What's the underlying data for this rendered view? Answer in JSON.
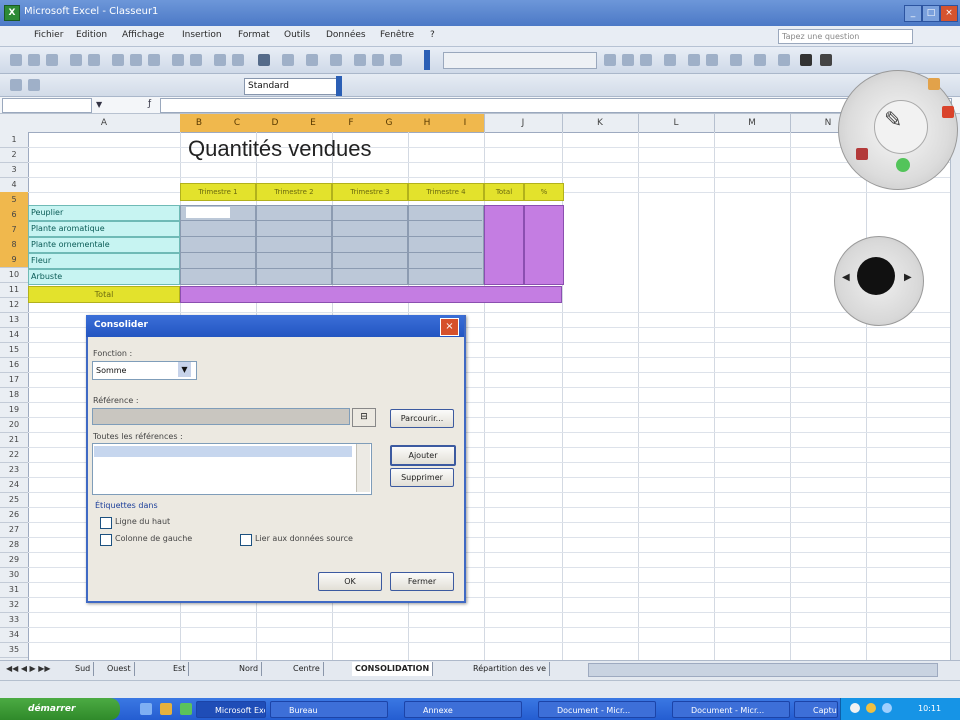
{
  "window": {
    "title": "Microsoft Excel - Classeur1",
    "app_icon": "excel-icon"
  },
  "menu": {
    "items": [
      "Fichier",
      "Edition",
      "Affichage",
      "Insertion",
      "Format",
      "Outils",
      "Données",
      "Fenêtre",
      "?"
    ],
    "help_placeholder": "Tapez une question"
  },
  "toolbar": {
    "zoom": "Standard"
  },
  "columns": {
    "headers": [
      "A",
      "B",
      "C",
      "D",
      "E",
      "F",
      "G",
      "H",
      "I",
      "J",
      "K",
      "L",
      "M",
      "N"
    ]
  },
  "rows": {
    "headers": [
      "1",
      "2",
      "3",
      "4",
      "5",
      "6",
      "7",
      "8",
      "9",
      "10",
      "11",
      "12",
      "13",
      "14",
      "15",
      "16",
      "17",
      "18",
      "19",
      "20",
      "21",
      "22",
      "23",
      "24",
      "25",
      "26",
      "27",
      "28",
      "29",
      "30",
      "31",
      "32",
      "33",
      "34",
      "35"
    ]
  },
  "sheet": {
    "title": "Quantités vendues",
    "table_headers": [
      "Trimestre 1",
      "Trimestre 2",
      "Trimestre 3",
      "Trimestre 4",
      "Total",
      "%"
    ],
    "row_labels": [
      "Peuplier",
      "Plante aromatique",
      "Plante ornementale",
      "Fleur",
      "Arbuste"
    ],
    "total_label": "Total"
  },
  "dialog": {
    "title": "Consolider",
    "function_label": "Fonction :",
    "function_value": "Somme",
    "reference_label": "Référence :",
    "browse_button": "Parcourir...",
    "all_refs_label": "Toutes les références :",
    "add_button": "Ajouter",
    "delete_button": "Supprimer",
    "labels_group": "Étiquettes dans",
    "top_row_label": "Ligne du haut",
    "left_col_label": "Colonne de gauche",
    "link_label": "Lier aux données source",
    "ok_button": "OK",
    "close_button": "Fermer"
  },
  "sheet_tabs": [
    "Sud",
    "Ouest",
    "Est",
    "Nord",
    "Centre",
    "CONSOLIDATION",
    "Répartition des ve"
  ],
  "taskbar": {
    "start_label": "démarrer",
    "buttons": [
      "Bureau",
      "Annexe",
      "Document - Micr...",
      "Document - Micr...",
      "Microsoft Excel",
      "Capture vidéo"
    ],
    "clock": "10:11"
  },
  "colors": {
    "accent": "#3f69c4",
    "header_yellow": "#e3e22c",
    "label_cyan": "#c7f4f2",
    "total_magenta": "#c47de2"
  }
}
